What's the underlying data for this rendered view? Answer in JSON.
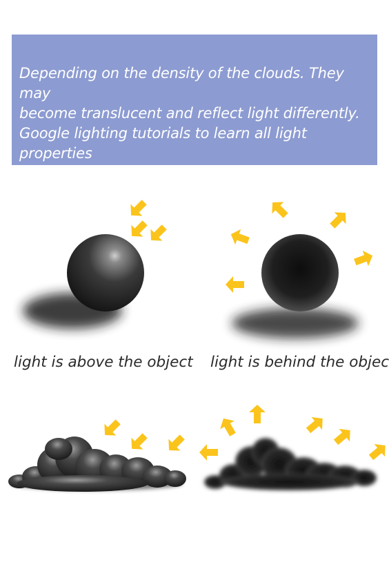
{
  "banner": {
    "text": "Depending on the density of the clouds. They may\nbecome translucent and reflect light differently.\nGoogle lighting tutorials to learn all light properties"
  },
  "captions": {
    "above": "light is above the object",
    "behind": "light is behind the object"
  },
  "colors": {
    "banner": "#8c9bd1",
    "arrow": "#fbc41c",
    "object": "#1a1a1a"
  }
}
